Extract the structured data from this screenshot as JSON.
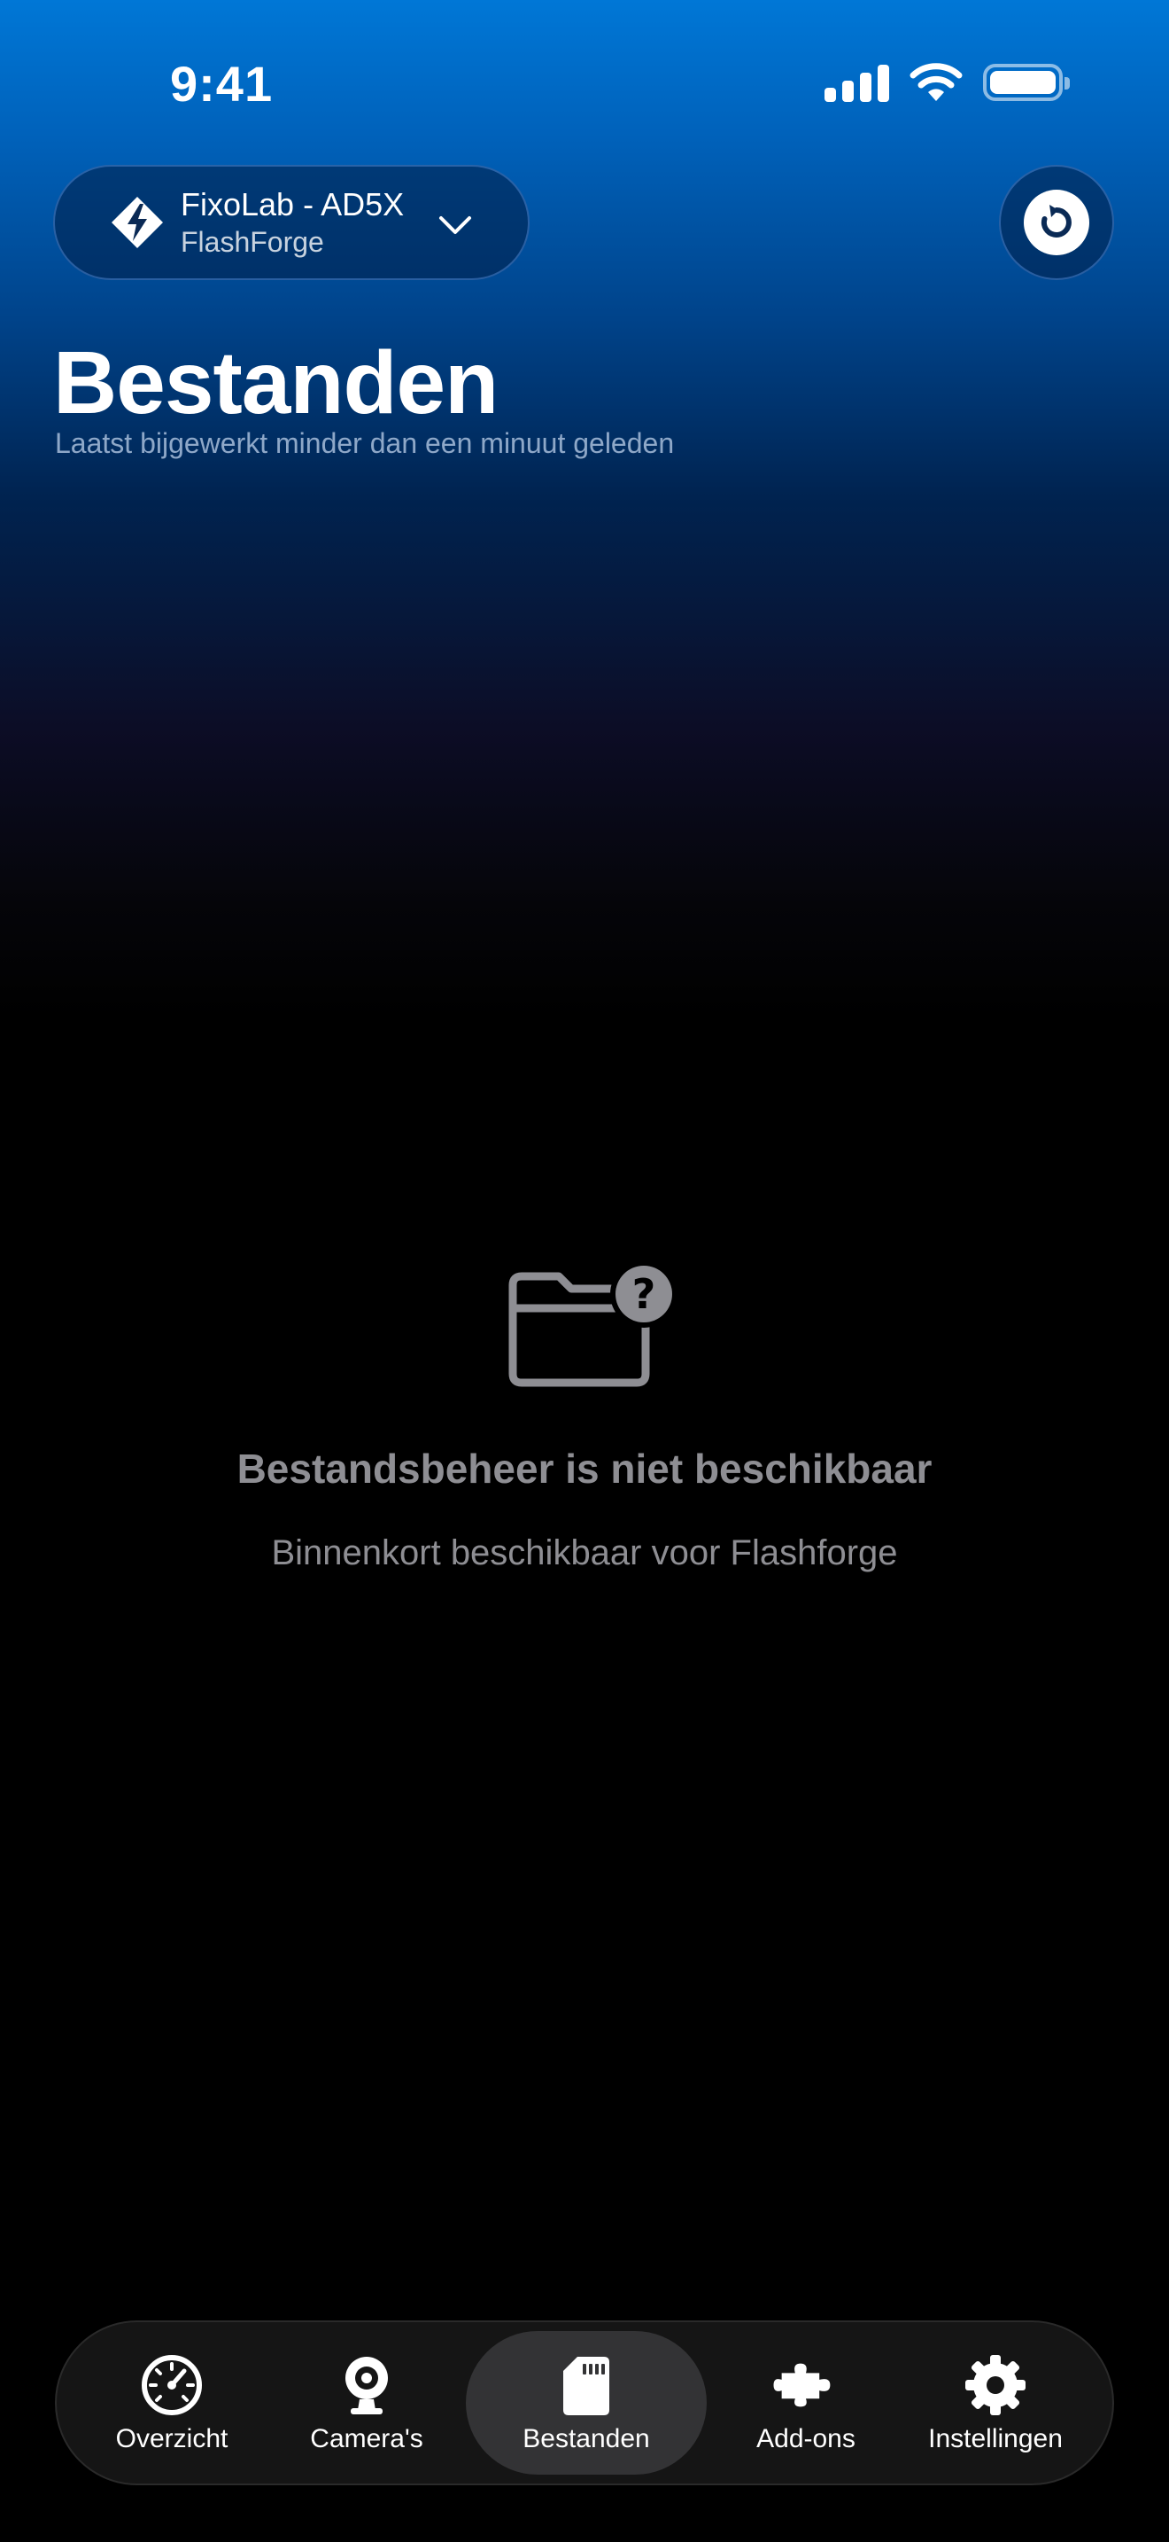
{
  "status_bar": {
    "time": "9:41"
  },
  "printer_selector": {
    "name": "FixoLab - AD5X",
    "brand": "FlashForge",
    "logo_icon": "flashforge-logo-icon",
    "chevron_icon": "chevron-down-icon"
  },
  "header": {
    "title": "Bestanden",
    "subtitle": "Laatst bijgewerkt minder dan een minuut geleden",
    "refresh_icon": "refresh-icon"
  },
  "empty_state": {
    "icon": "folder-question-icon",
    "title": "Bestandsbeheer is niet beschikbaar",
    "subtitle": "Binnenkort beschikbaar voor Flashforge"
  },
  "tab_bar": {
    "active_tab": "Bestanden",
    "tabs": [
      {
        "label": "Overzicht",
        "icon": "gauge-icon"
      },
      {
        "label": "Camera's",
        "icon": "webcam-icon"
      },
      {
        "label": "Bestanden",
        "icon": "sd-card-icon"
      },
      {
        "label": "Add-ons",
        "icon": "puzzle-icon"
      },
      {
        "label": "Instellingen",
        "icon": "gear-icon"
      }
    ]
  },
  "colors": {
    "gradient_top": "#0077d6",
    "background": "#000000",
    "muted_text": "#8e8e93",
    "tab_bar_bg": "#151515",
    "active_tab_bg": "#333335"
  }
}
